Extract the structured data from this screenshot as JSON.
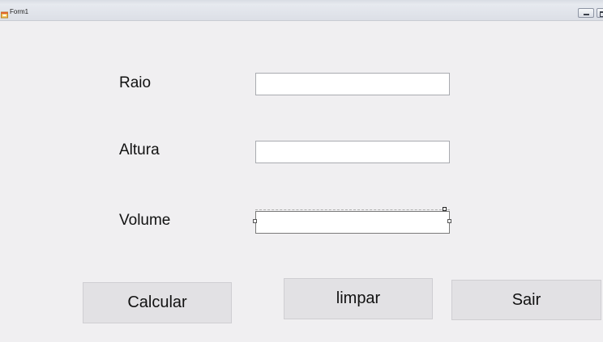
{
  "window": {
    "title": "Form1",
    "icon": "form-app-icon",
    "controls": {
      "minimize_icon": "minimize-icon",
      "maximize_icon": "maximize-icon"
    }
  },
  "form": {
    "fields": [
      {
        "label": "Raio",
        "value": "",
        "placeholder": ""
      },
      {
        "label": "Altura",
        "value": "",
        "placeholder": ""
      },
      {
        "label": "Volume",
        "value": "",
        "placeholder": ""
      }
    ]
  },
  "buttons": {
    "calcular": "Calcular",
    "limpar": "limpar",
    "sair": "Sair"
  },
  "colors": {
    "background": "#f0eff1",
    "button_face": "#e2e1e4",
    "textbox_border": "#a9abb0"
  }
}
